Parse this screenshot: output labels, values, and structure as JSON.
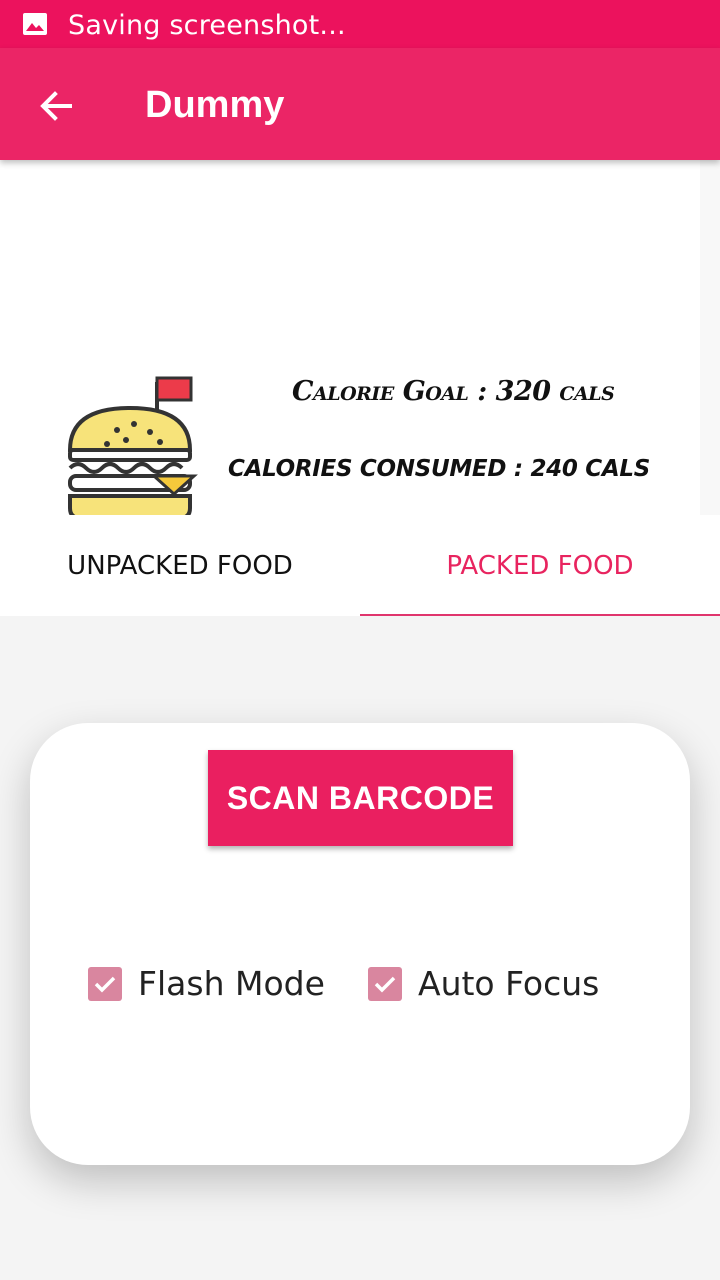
{
  "status_bar": {
    "text": "Saving screenshot...",
    "icon": "image-icon",
    "color": "#ec125d"
  },
  "app_bar": {
    "title": "Dummy",
    "back_icon": "arrow-back-icon",
    "color": "#eb2566"
  },
  "summary": {
    "calorie_goal": "Calorie Goal : 320 cals",
    "calories_consumed": "CALORIES CONSUMED : 240 CALS",
    "illustration_icon": "burger-flag-icon"
  },
  "tabs": [
    {
      "label": "UNPACKED FOOD",
      "selected": false
    },
    {
      "label": "PACKED FOOD",
      "selected": true
    }
  ],
  "scanner": {
    "button_label": "SCAN BARCODE",
    "options": [
      {
        "label": "Flash Mode",
        "checked": true
      },
      {
        "label": "Auto Focus",
        "checked": true
      }
    ]
  },
  "colors": {
    "accent": "#ea1f60",
    "checkbox": "#d9869f"
  }
}
